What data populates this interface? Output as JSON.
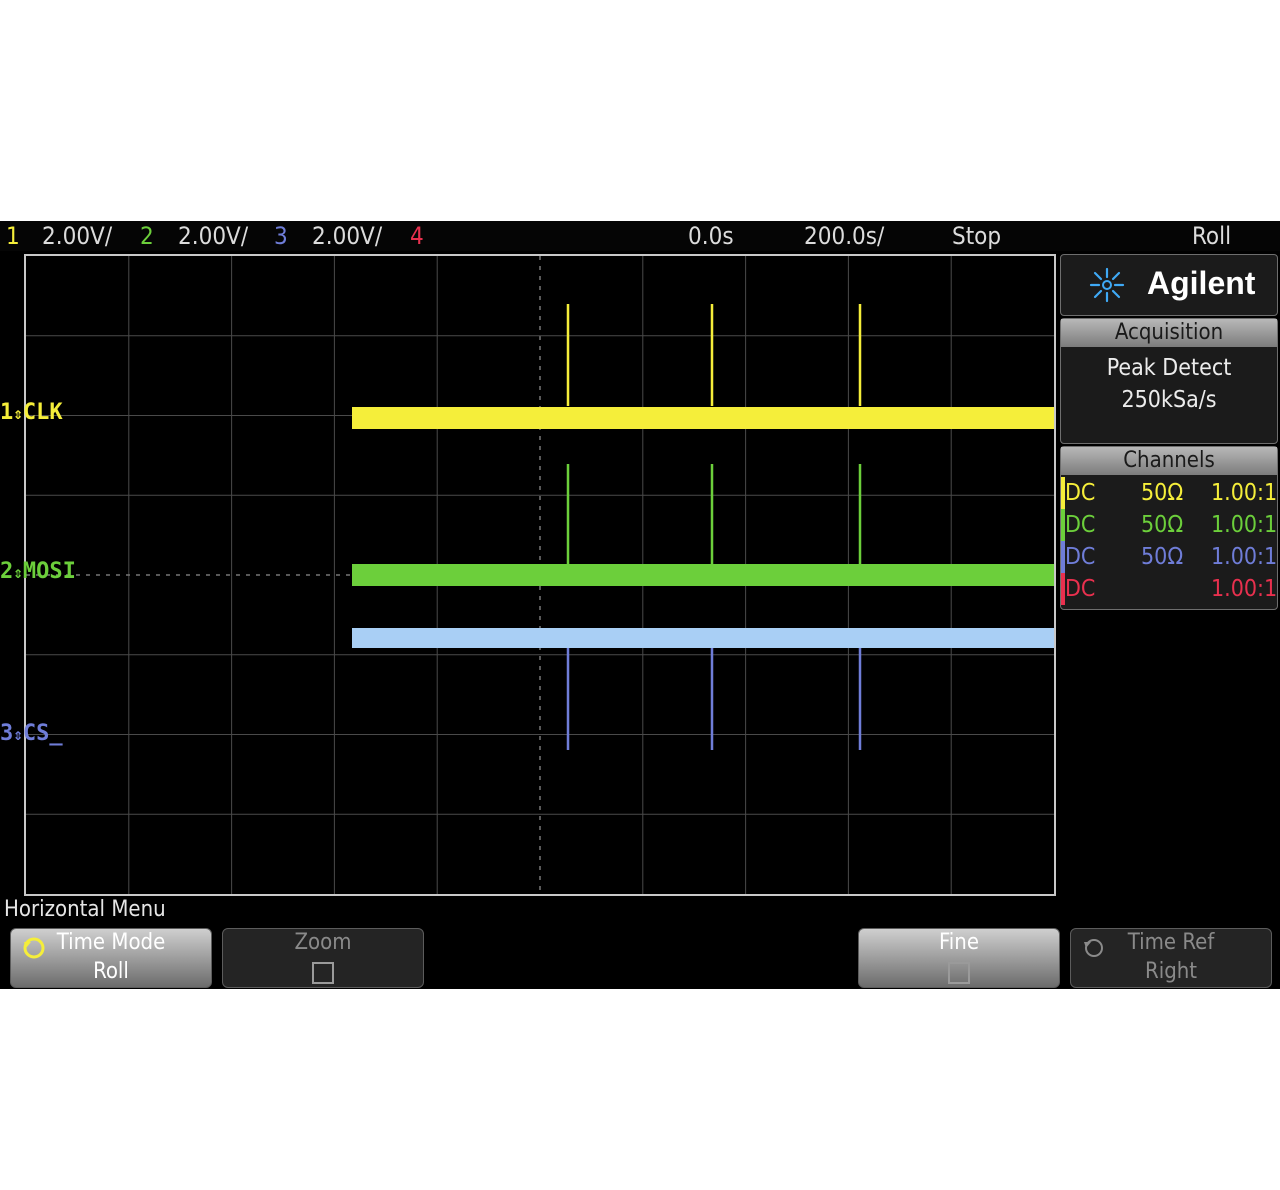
{
  "topbar": {
    "ch1_num": "1",
    "ch1_scale": "2.00V/",
    "ch2_num": "2",
    "ch2_scale": "2.00V/",
    "ch3_num": "3",
    "ch3_scale": "2.00V/",
    "ch4_num": "4",
    "delay": "0.0s",
    "timebase": "200.0s/",
    "run_state": "Stop",
    "mode": "Roll"
  },
  "waveforms": {
    "ch1_marker": "1",
    "ch1_label": "CLK",
    "ch2_marker": "2",
    "ch2_label": "MOSI",
    "ch3_marker": "3",
    "ch3_label": "CS_"
  },
  "panel": {
    "brand": "Agilent",
    "acquisition_header": "Acquisition",
    "acquisition_mode": "Peak Detect",
    "sample_rate": "250kSa/s",
    "channels_header": "Channels",
    "channels": [
      {
        "coupling": "DC",
        "impedance": "50Ω",
        "probe": "1.00:1"
      },
      {
        "coupling": "DC",
        "impedance": "50Ω",
        "probe": "1.00:1"
      },
      {
        "coupling": "DC",
        "impedance": "50Ω",
        "probe": "1.00:1"
      },
      {
        "coupling": "DC",
        "impedance": "",
        "probe": "1.00:1"
      }
    ]
  },
  "menu": {
    "title": "Horizontal Menu",
    "softkeys": [
      {
        "label": "Time Mode",
        "value": "Roll"
      },
      {
        "label": "Zoom",
        "value": ""
      },
      {
        "label": "Fine",
        "value": ""
      },
      {
        "label": "Time Ref",
        "value": "Right"
      }
    ]
  },
  "colors": {
    "ch1": "#f5ee3a",
    "ch2": "#6ccf3b",
    "ch3": "#6f7dd8",
    "ch3_trace": "#a9cff5",
    "ch4": "#e8304e"
  }
}
